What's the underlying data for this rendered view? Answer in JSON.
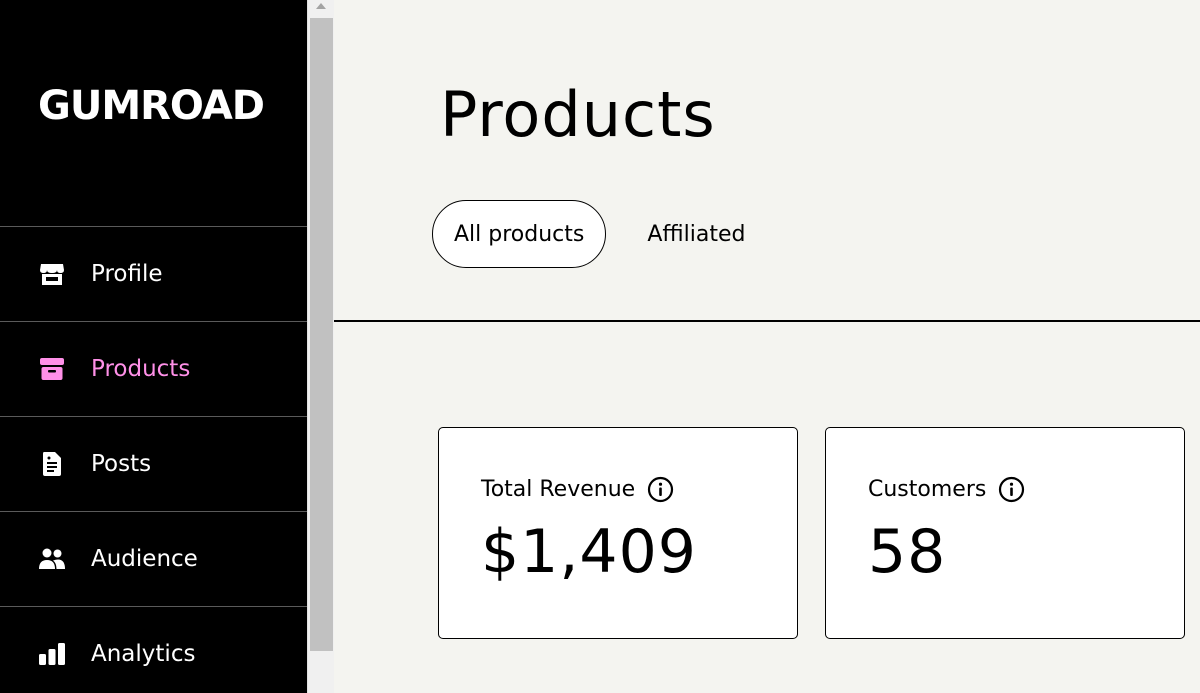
{
  "sidebar": {
    "logo": "GUMROAD",
    "items": [
      {
        "label": "Profile",
        "icon": "store-icon",
        "active": false
      },
      {
        "label": "Products",
        "icon": "archive-box-icon",
        "active": true
      },
      {
        "label": "Posts",
        "icon": "document-icon",
        "active": false
      },
      {
        "label": "Audience",
        "icon": "users-icon",
        "active": false
      },
      {
        "label": "Analytics",
        "icon": "bar-chart-icon",
        "active": false
      }
    ]
  },
  "main": {
    "title": "Products",
    "tabs": [
      {
        "label": "All products",
        "active": true
      },
      {
        "label": "Affiliated",
        "active": false
      }
    ],
    "stats": [
      {
        "label": "Total Revenue",
        "value": "$1,409"
      },
      {
        "label": "Customers",
        "value": "58"
      }
    ]
  },
  "colors": {
    "sidebar_bg": "#000000",
    "active_accent": "#ff90e8",
    "main_bg": "#f4f4f0"
  }
}
